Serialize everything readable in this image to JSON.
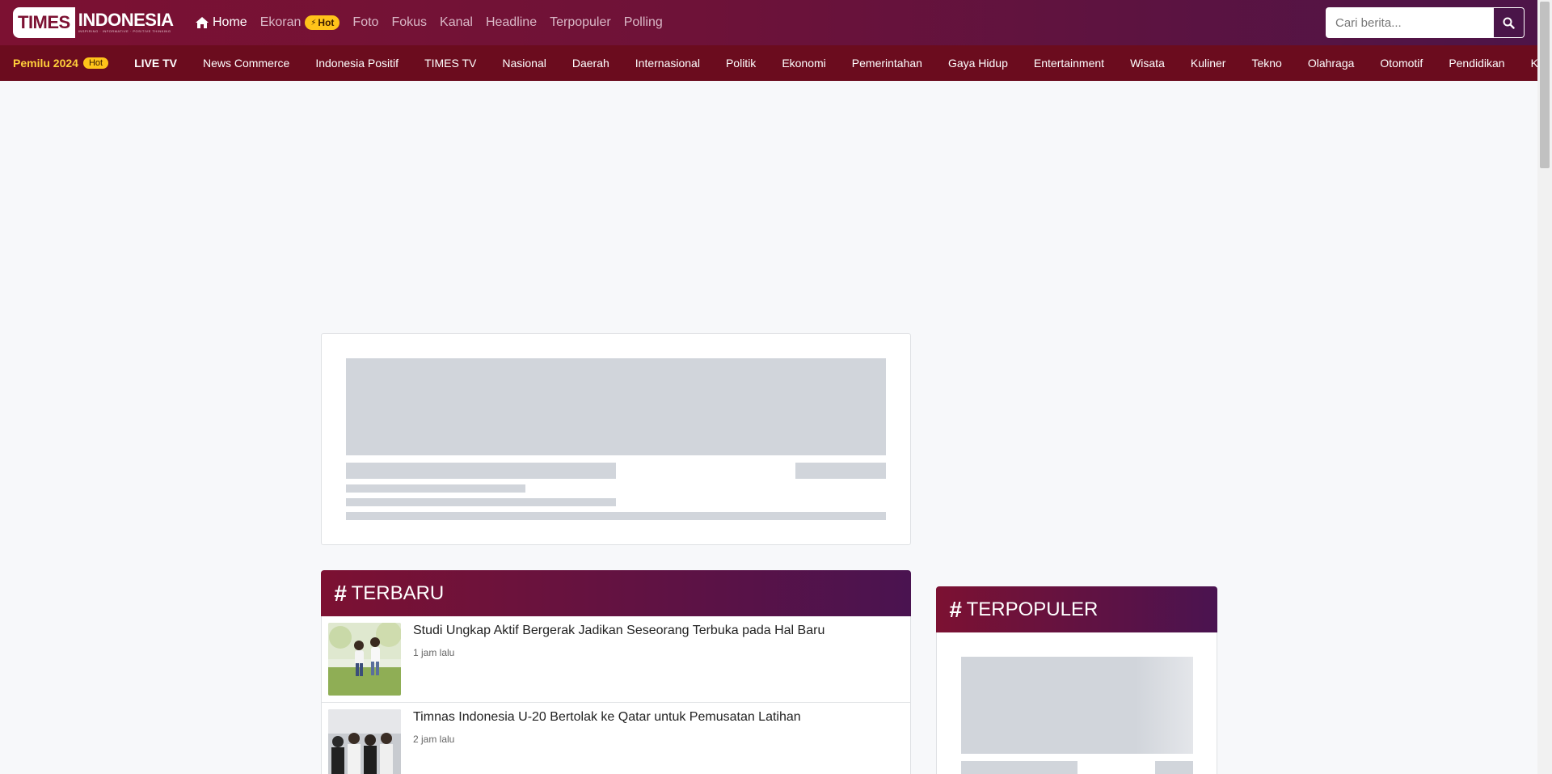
{
  "logo": {
    "times": "TIMES",
    "indonesia": "INDONESIA",
    "tagline": "INSPIRING · INFORMATIVE · POSITIVE THINKING"
  },
  "main_nav": {
    "home": "Home",
    "ekoran": "Ekoran",
    "ekoran_badge": "Hot",
    "foto": "Foto",
    "fokus": "Fokus",
    "kanal": "Kanal",
    "headline": "Headline",
    "terpopuler": "Terpopuler",
    "polling": "Polling"
  },
  "search": {
    "placeholder": "Cari berita...",
    "icon": "search-icon"
  },
  "category_bar": {
    "pemilu": "Pemilu 2024",
    "pemilu_badge": "Hot",
    "items": [
      "LIVE TV",
      "News Commerce",
      "Indonesia Positif",
      "TIMES TV",
      "Nasional",
      "Daerah",
      "Internasional",
      "Politik",
      "Ekonomi",
      "Pemerintahan",
      "Gaya Hidup",
      "Entertainment",
      "Wisata",
      "Kuliner",
      "Tekno",
      "Olahraga",
      "Otomotif",
      "Pendidikan",
      "Keseh"
    ]
  },
  "terbaru": {
    "hash": "#",
    "title": "TERBARU",
    "items": [
      {
        "title": "Studi Ungkap Aktif Bergerak Jadikan Seseorang Terbuka pada Hal Baru",
        "time": "1 jam lalu"
      },
      {
        "title": "Timnas Indonesia U-20 Bertolak ke Qatar untuk Pemusatan Latihan",
        "time": "2 jam lalu"
      }
    ]
  },
  "terpopuler": {
    "hash": "#",
    "title": "TERPOPULER"
  },
  "colors": {
    "brand": "#7c1132",
    "brand_dark": "#4a1350",
    "category_bar": "#6b0c1e",
    "badge": "#ffc31a",
    "skeleton": "#d1d5db"
  }
}
